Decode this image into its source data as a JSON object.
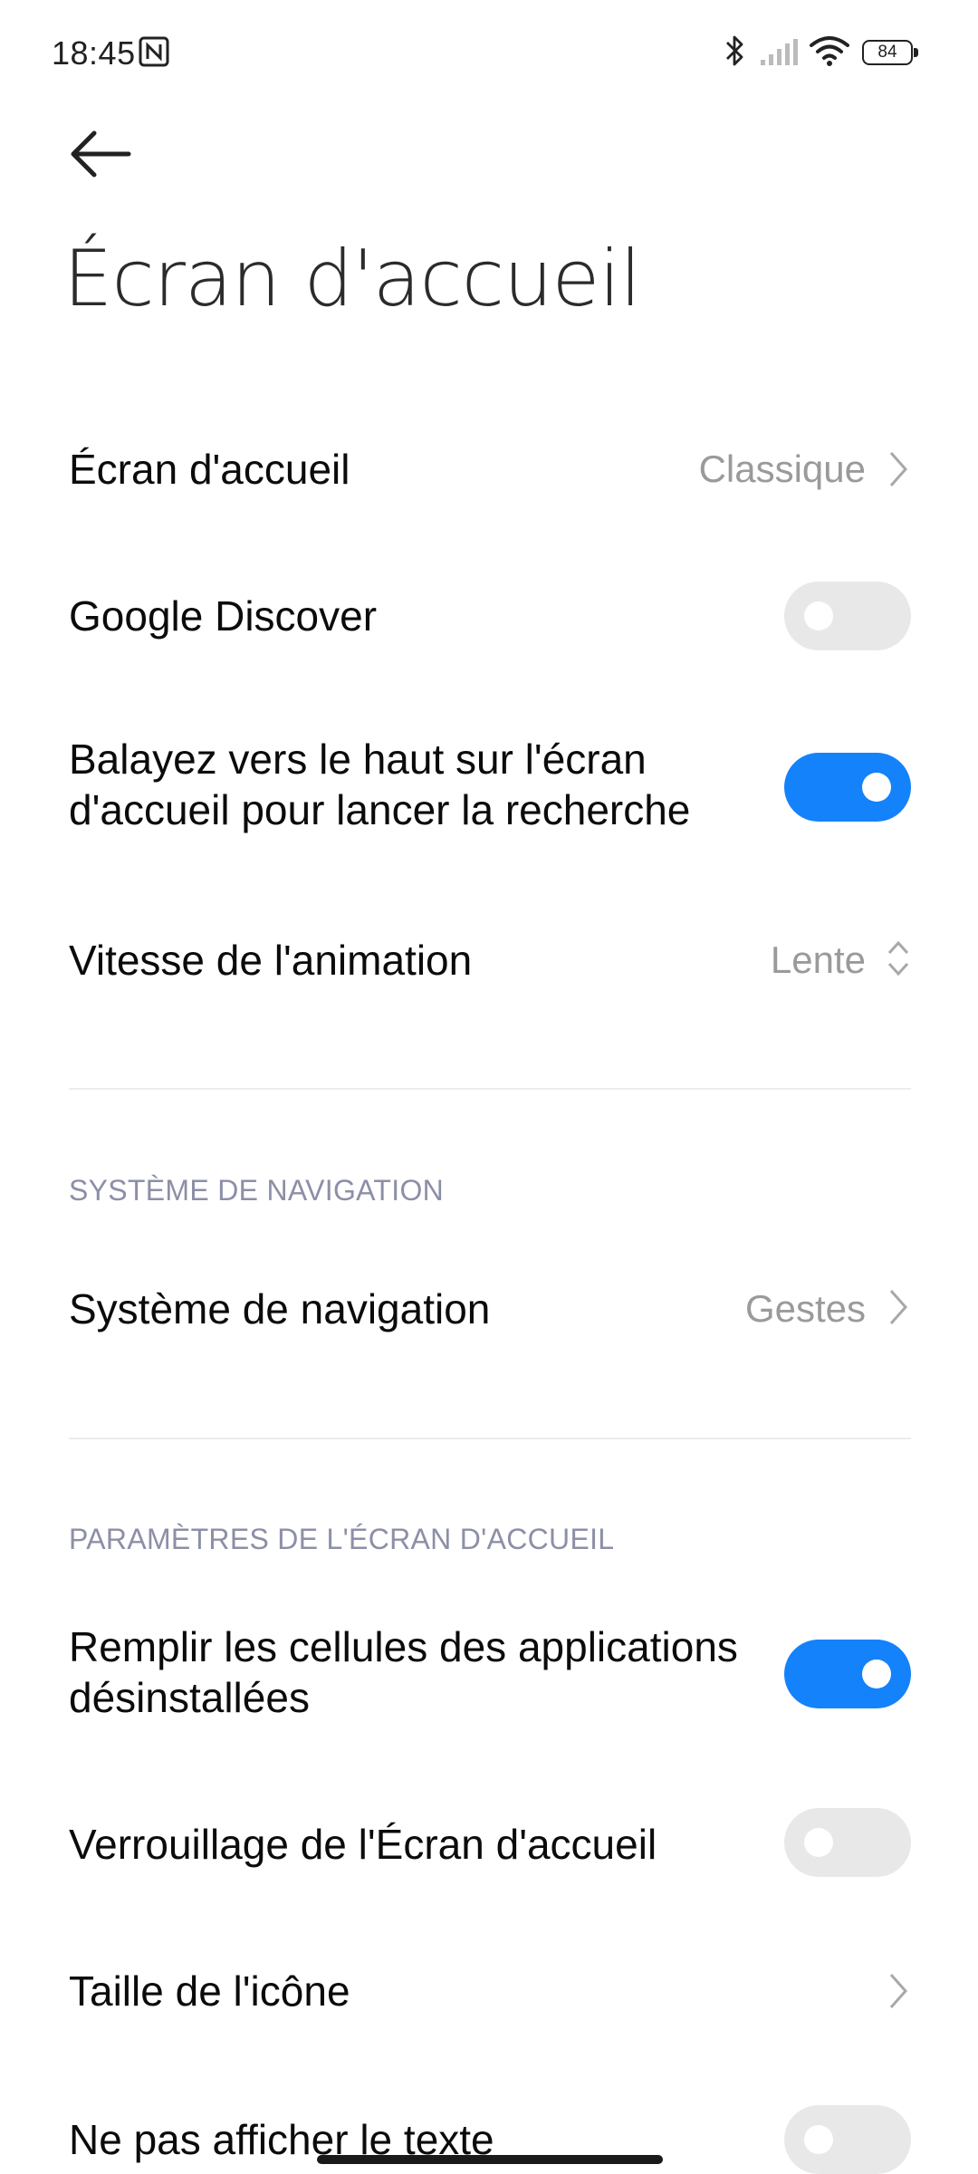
{
  "status_bar": {
    "time": "18:45",
    "battery": "84",
    "icons": [
      "nfc-icon",
      "bluetooth-icon",
      "signal-icon",
      "wifi-icon",
      "battery-icon"
    ]
  },
  "header": {
    "title": "Écran d'accueil"
  },
  "settings": {
    "home_screen": {
      "label": "Écran d'accueil",
      "value": "Classique"
    },
    "google_discover": {
      "label": "Google Discover",
      "enabled": false
    },
    "swipe_search": {
      "label": "Balayez vers le haut sur l'écran d'accueil pour lancer la recherche",
      "enabled": true
    },
    "animation_speed": {
      "label": "Vitesse de l'animation",
      "value": "Lente"
    }
  },
  "navigation": {
    "section_header": "SYSTÈME DE NAVIGATION",
    "system": {
      "label": "Système de navigation",
      "value": "Gestes"
    }
  },
  "home_params": {
    "section_header": "PARAMÈTRES DE L'ÉCRAN D'ACCUEIL",
    "fill_cells": {
      "label": "Remplir les cellules des applications désinstallées",
      "enabled": true
    },
    "lock_layout": {
      "label": "Verrouillage de l'Écran d'accueil",
      "enabled": false
    },
    "icon_size": {
      "label": "Taille de l'icône"
    },
    "hide_text": {
      "label": "Ne pas afficher le texte",
      "enabled": false
    }
  },
  "colors": {
    "toggle_on": "#1482fa",
    "toggle_off": "#e8e8e8",
    "section_header": "#8c8fa6",
    "secondary_value": "#9a9a9a"
  }
}
